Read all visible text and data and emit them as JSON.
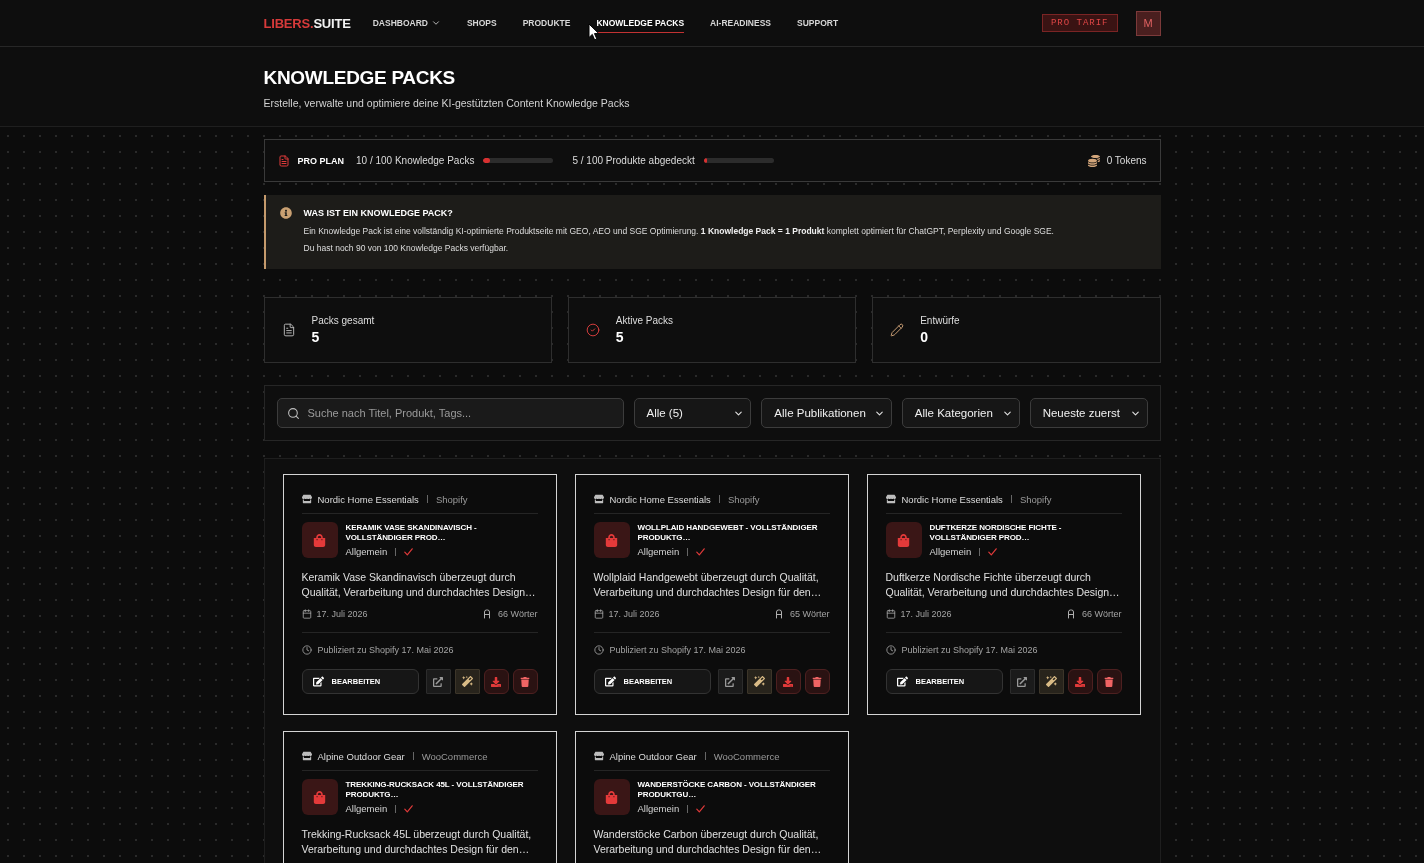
{
  "header": {
    "logo": {
      "accent": "LIBERS.",
      "text": "SUITE"
    },
    "nav": [
      {
        "label": "DASHBOARD",
        "kind": "menu",
        "selected": false
      },
      {
        "label": "SHOPS",
        "kind": "link",
        "selected": false
      },
      {
        "label": "PRODUKTE",
        "kind": "link",
        "selected": false
      },
      {
        "label": "KNOWLEDGE PACKS",
        "kind": "link",
        "selected": true
      },
      {
        "label": "AI-READINESS",
        "kind": "link",
        "selected": false
      },
      {
        "label": "SUPPORT",
        "kind": "link",
        "selected": false
      }
    ],
    "plan_badge": "PRO TARIF",
    "avatar": "M"
  },
  "page": {
    "title": "KNOWLEDGE PACKS",
    "subtitle": "Erstelle, verwalte und optimiere deine KI-gestützten Content Knowledge Packs"
  },
  "usage_bar": {
    "plan": "PRO PLAN",
    "meters": [
      {
        "label": "10 / 100 Knowledge Packs",
        "level": 0.1
      },
      {
        "label": "5 / 100 Produkte abgedeckt",
        "level": 0.05
      }
    ],
    "tokens": "0 Tokens"
  },
  "info": {
    "title": "WAS IST EIN KNOWLEDGE PACK?",
    "lines": [
      "Ein Knowledge Pack ist eine vollständig KI-optimierte Produktseite mit GEO, AEO und SGE Optimierung. **1 Knowledge Pack = 1 Produkt** komplett optimiert für ChatGPT, Perplexity und Google SGE.",
      "Du hast noch 90 von 100 Knowledge Packs verfügbar."
    ]
  },
  "stats": [
    {
      "kind": "total",
      "label": "Packs gesamt",
      "value": "5"
    },
    {
      "kind": "active",
      "label": "Aktive Packs",
      "value": "5"
    },
    {
      "kind": "drafts",
      "label": "Entwürfe",
      "value": "0"
    }
  ],
  "filters": {
    "search": {
      "placeholder": "Suche nach Titel, Produkt, Tags..."
    },
    "selects": [
      "Alle (5)",
      "Alle Publikationen",
      "Alle Kategorien",
      "Neueste zuerst"
    ]
  },
  "packs": [
    {
      "shop": "Nordic Home Essentials",
      "platform": "Shopify",
      "title": "KERAMIK VASE SKANDINAVISCH - VOLLSTÄNDIGER PROD…",
      "category": "Allgemein",
      "verified": true,
      "description": "Keramik Vase Skandinavisch überzeugt durch Qualität, Verarbeitung und durchdachtes Design…",
      "date": "17. Juli 2026",
      "words": "66 Wörter",
      "published": "Publiziert zu Shopify 17. Mai 2026",
      "edit_label": "BEARBEITEN"
    },
    {
      "shop": "Nordic Home Essentials",
      "platform": "Shopify",
      "title": "WOLLPLAID HANDGEWEBT - VOLLSTÄNDIGER PRODUKTG…",
      "category": "Allgemein",
      "verified": true,
      "description": "Wollplaid Handgewebt überzeugt durch Qualität, Verarbeitung und durchdachtes Design für den…",
      "date": "17. Juli 2026",
      "words": "65 Wörter",
      "published": "Publiziert zu Shopify 17. Mai 2026",
      "edit_label": "BEARBEITEN"
    },
    {
      "shop": "Nordic Home Essentials",
      "platform": "Shopify",
      "title": "DUFTKERZE NORDISCHE FICHTE - VOLLSTÄNDIGER PROD…",
      "category": "Allgemein",
      "verified": true,
      "description": "Duftkerze Nordische Fichte überzeugt durch Qualität, Verarbeitung und durchdachtes Design…",
      "date": "17. Juli 2026",
      "words": "66 Wörter",
      "published": "Publiziert zu Shopify 17. Mai 2026",
      "edit_label": "BEARBEITEN"
    },
    {
      "shop": "Alpine Outdoor Gear",
      "platform": "WooCommerce",
      "title": "TREKKING-RUCKSACK 45L - VOLLSTÄNDIGER PRODUKTG…",
      "category": "Allgemein",
      "verified": true,
      "description": "Trekking-Rucksack 45L überzeugt durch Qualität, Verarbeitung und durchdachtes Design für den…"
    },
    {
      "shop": "Alpine Outdoor Gear",
      "platform": "WooCommerce",
      "title": "WANDERSTÖCKE CARBON - VOLLSTÄNDIGER PRODUKTGU…",
      "category": "Allgemein",
      "verified": true,
      "description": "Wanderstöcke Carbon überzeugt durch Qualität, Verarbeitung und durchdachtes Design für den…"
    }
  ]
}
